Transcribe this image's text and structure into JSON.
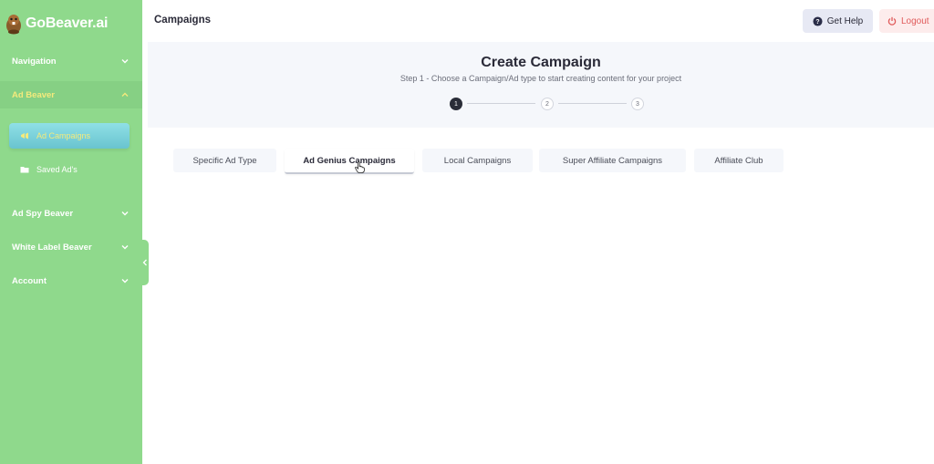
{
  "app": {
    "name": "GoBeaver.ai"
  },
  "sidebar": {
    "sections": [
      {
        "label": "Navigation"
      },
      {
        "label": "Ad Beaver"
      },
      {
        "label": "Ad Spy Beaver"
      },
      {
        "label": "White Label Beaver"
      },
      {
        "label": "Account"
      }
    ],
    "sub_items": [
      {
        "label": "Ad Campaigns"
      },
      {
        "label": "Saved Ad's"
      }
    ]
  },
  "topbar": {
    "title": "Campaigns",
    "help_label": "Get Help",
    "logout_label": "Logout"
  },
  "header": {
    "title": "Create Campaign",
    "subtitle": "Step 1 - Choose a Campaign/Ad type to start creating content for your project",
    "steps": [
      "1",
      "2",
      "3"
    ]
  },
  "tabs": [
    {
      "label": "Specific Ad Type"
    },
    {
      "label": "Ad Genius Campaigns"
    },
    {
      "label": "Local Campaigns"
    },
    {
      "label": "Super Affiliate Campaigns"
    },
    {
      "label": "Affiliate Club"
    }
  ],
  "colors": {
    "sidebar": "#8fd98c",
    "active_item": "#69c4cf",
    "highlight_text": "#f4ea7c",
    "logout": "#e05a5a"
  }
}
